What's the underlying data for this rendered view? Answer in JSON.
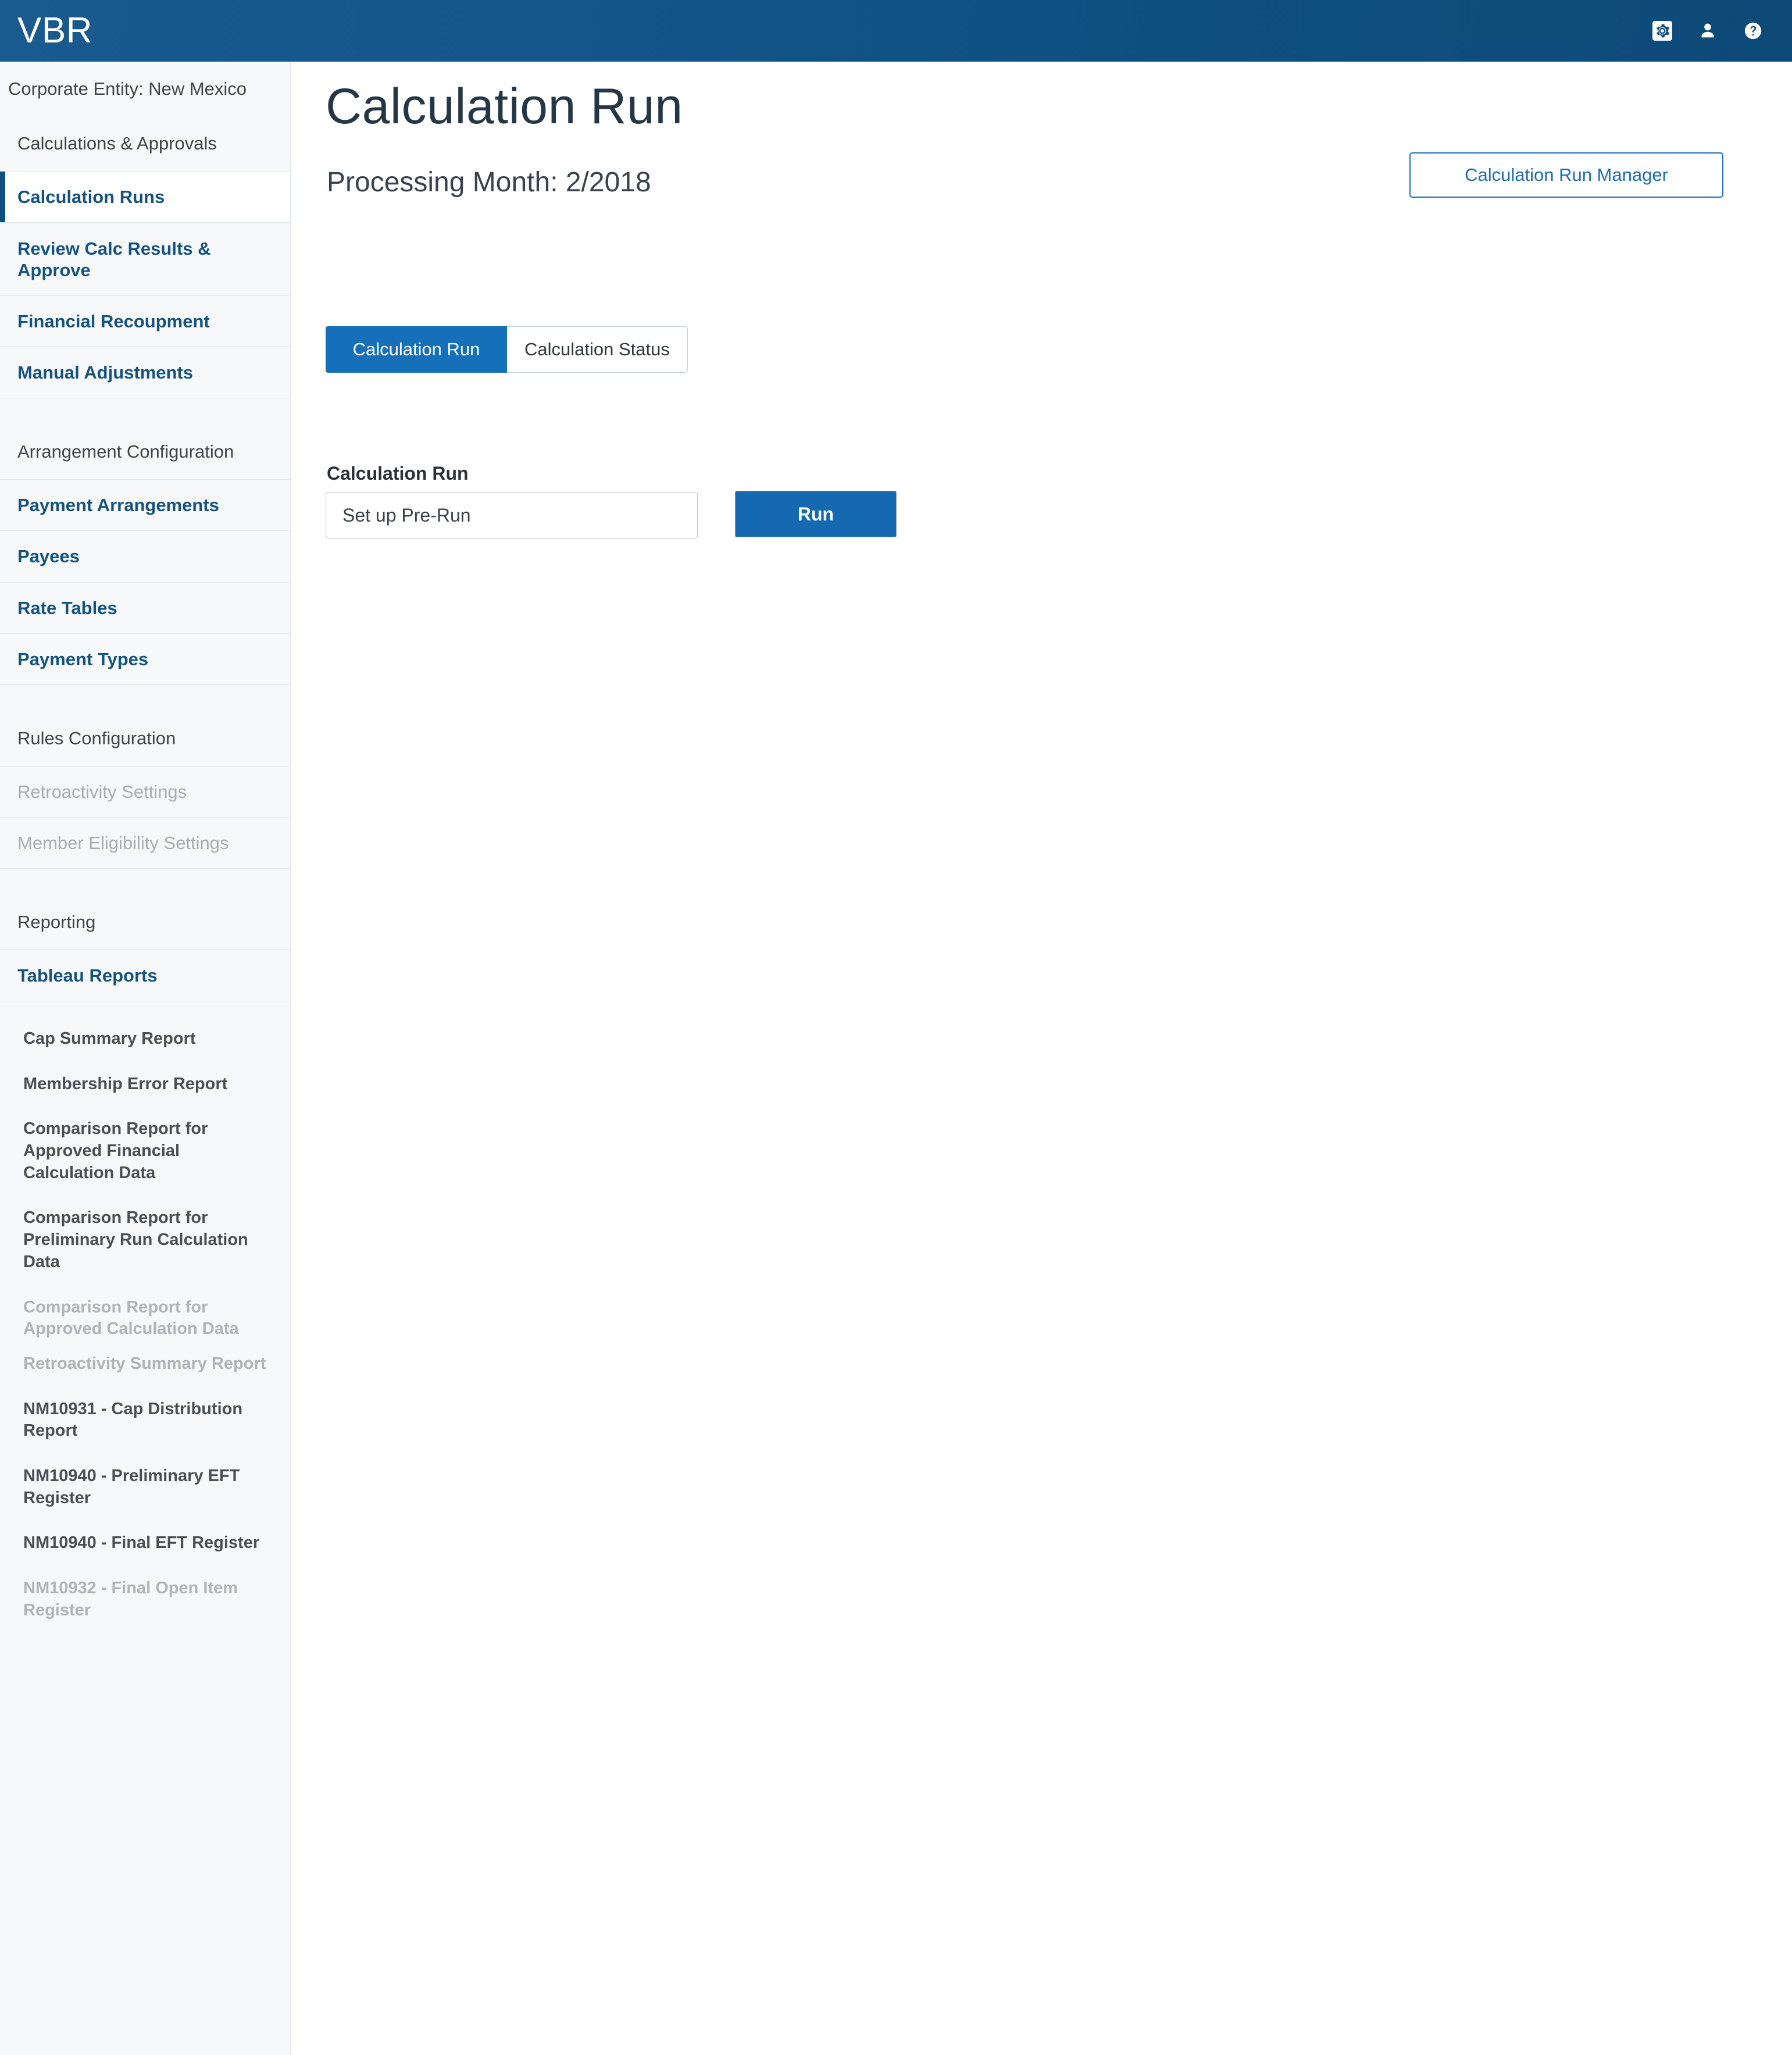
{
  "app": {
    "brand": "VBR",
    "header_icons": [
      {
        "name": "settings-gear-icon",
        "label": "Settings"
      },
      {
        "name": "user-person-icon",
        "label": "User"
      },
      {
        "name": "help-question-icon",
        "label": "Help"
      }
    ],
    "colors": {
      "header_blue": "#0f4f80",
      "accent_blue": "#1570b9",
      "link_blue": "#15527f",
      "sidebar_bg": "#f6f8fa",
      "muted_text": "#a8adb2"
    }
  },
  "sidebar": {
    "entity_header": "Corporate Entity: New Mexico",
    "group_calculations_label": "Calculations & Approvals",
    "calc_items": [
      {
        "label": "Calculation Runs",
        "active": true,
        "disabled": false
      },
      {
        "label": "Review Calc Results & Approve",
        "active": false,
        "disabled": false
      },
      {
        "label": "Financial Recoupment",
        "active": false,
        "disabled": false
      },
      {
        "label": "Manual Adjustments",
        "active": false,
        "disabled": false
      }
    ],
    "group_arrangement_label": "Arrangement Configuration",
    "arrangement_items": [
      {
        "label": "Payment Arrangements",
        "disabled": false
      },
      {
        "label": "Payees",
        "disabled": false
      },
      {
        "label": "Rate Tables",
        "disabled": false
      },
      {
        "label": "Payment Types",
        "disabled": false
      }
    ],
    "group_rules_label": "Rules Configuration",
    "rules_items": [
      {
        "label": "Retroactivity Settings",
        "disabled": true
      },
      {
        "label": "Member Eligibility Settings",
        "disabled": true
      }
    ],
    "group_reporting_label": "Reporting",
    "tableau_link_label": "Tableau Reports",
    "reports": [
      {
        "label": "Cap Summary Report",
        "disabled": false
      },
      {
        "label": "Membership Error Report",
        "disabled": false
      },
      {
        "label": "Comparison Report for Approved Financial Calculation Data",
        "disabled": false
      },
      {
        "label": "Comparison Report for Preliminary Run Calculation Data",
        "disabled": false
      },
      {
        "label": "Comparison Report for Approved Calculation Data",
        "disabled": true
      },
      {
        "label": "Retroactivity Summary Report",
        "disabled": true
      },
      {
        "label": "NM10931 - Cap Distribution Report",
        "disabled": false
      },
      {
        "label": "NM10940 - Preliminary EFT Register",
        "disabled": false
      },
      {
        "label": "NM10940 - Final EFT Register",
        "disabled": false
      },
      {
        "label": "NM10932 - Final Open Item Register",
        "disabled": true
      }
    ]
  },
  "main": {
    "title": "Calculation Run",
    "subtitle": "Processing Month: 2/2018",
    "manager_button_label": "Calculation Run Manager",
    "tabs": [
      {
        "label": "Calculation Run",
        "selected": true
      },
      {
        "label": "Calculation Status",
        "selected": false
      }
    ],
    "form": {
      "section_label": "Calculation Run",
      "select_value": "Set up Pre-Run",
      "run_button_label": "Run"
    }
  }
}
